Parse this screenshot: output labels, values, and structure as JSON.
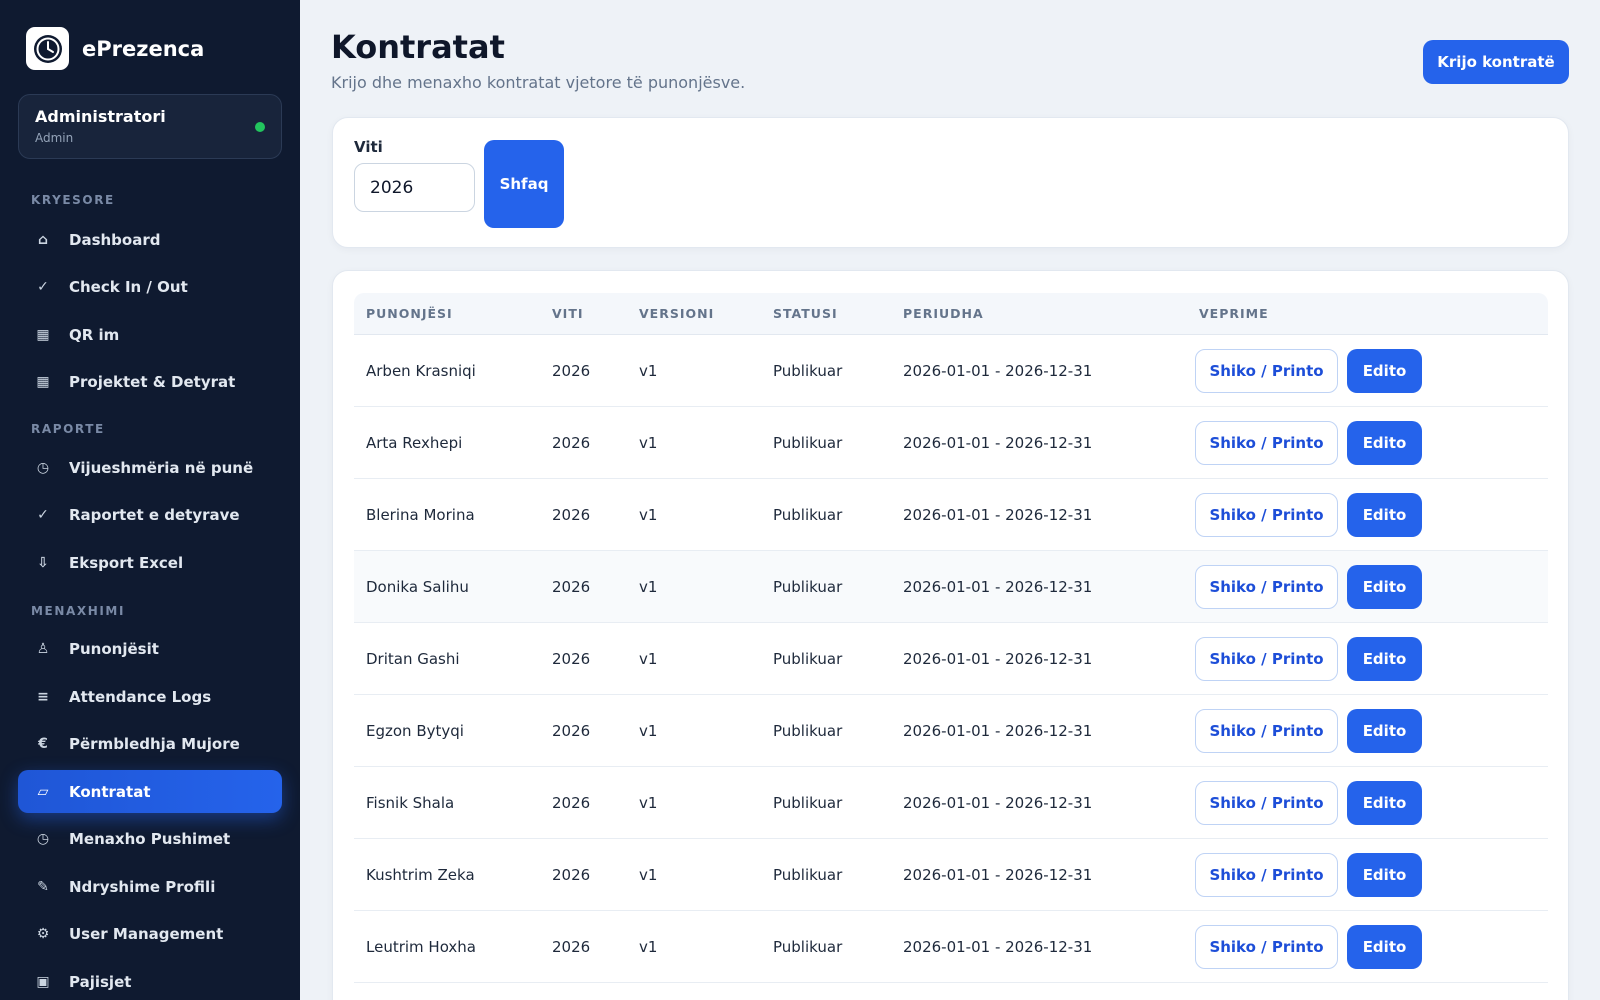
{
  "app": {
    "name": "ePrezenca",
    "logo_icon": "clock-icon"
  },
  "user": {
    "name": "Administratori",
    "role": "Admin",
    "status_color": "#22c55e"
  },
  "sidebar": {
    "sections": [
      {
        "title": "KRYESORE"
      },
      {
        "title": "RAPORTE"
      },
      {
        "title": "MENAXHIMI"
      }
    ],
    "items": [
      {
        "label": "Dashboard",
        "glyph": "⌂"
      },
      {
        "label": "Check In / Out",
        "glyph": "✓"
      },
      {
        "label": "QR im",
        "glyph": "▦"
      },
      {
        "label": "Projektet & Detyrat",
        "glyph": "▦"
      },
      {
        "label": "Vijueshmëria në punë",
        "glyph": "◷"
      },
      {
        "label": "Raportet e detyrave",
        "glyph": "✓"
      },
      {
        "label": "Eksport Excel",
        "glyph": "⇩"
      },
      {
        "label": "Punonjësit",
        "glyph": "♙"
      },
      {
        "label": "Attendance Logs",
        "glyph": "≡"
      },
      {
        "label": "Përmbledhja Mujore",
        "glyph": "€"
      },
      {
        "label": "Kontratat",
        "glyph": "▱",
        "active": true
      },
      {
        "label": "Menaxho Pushimet",
        "glyph": "◷"
      },
      {
        "label": "Ndryshime Profili",
        "glyph": "✎"
      },
      {
        "label": "User Management",
        "glyph": "⚙"
      },
      {
        "label": "Pajisjet",
        "glyph": "▣"
      }
    ]
  },
  "header": {
    "title": "Kontratat",
    "subtitle": "Krijo dhe menaxho kontratat vjetore të punonjësve.",
    "create_label": "Krijo kontratë"
  },
  "filter": {
    "label": "Viti",
    "year_value": "2026",
    "show_label": "Shfaq"
  },
  "table": {
    "columns": [
      "PUNONJËSI",
      "VITI",
      "VERSIONI",
      "STATUSI",
      "PERIUDHA",
      "VEPRIME"
    ],
    "view_label": "Shiko / Printo",
    "edit_label": "Edito",
    "rows": [
      {
        "employee": "Arben Krasniqi",
        "year": "2026",
        "version": "v1",
        "status": "Publikuar",
        "period": "2026-01-01 - 2026-12-31"
      },
      {
        "employee": "Arta Rexhepi",
        "year": "2026",
        "version": "v1",
        "status": "Publikuar",
        "period": "2026-01-01 - 2026-12-31"
      },
      {
        "employee": "Blerina Morina",
        "year": "2026",
        "version": "v1",
        "status": "Publikuar",
        "period": "2026-01-01 - 2026-12-31"
      },
      {
        "employee": "Donika Salihu",
        "year": "2026",
        "version": "v1",
        "status": "Publikuar",
        "period": "2026-01-01 - 2026-12-31"
      },
      {
        "employee": "Dritan Gashi",
        "year": "2026",
        "version": "v1",
        "status": "Publikuar",
        "period": "2026-01-01 - 2026-12-31"
      },
      {
        "employee": "Egzon Bytyqi",
        "year": "2026",
        "version": "v1",
        "status": "Publikuar",
        "period": "2026-01-01 - 2026-12-31"
      },
      {
        "employee": "Fisnik Shala",
        "year": "2026",
        "version": "v1",
        "status": "Publikuar",
        "period": "2026-01-01 - 2026-12-31"
      },
      {
        "employee": "Kushtrim Zeka",
        "year": "2026",
        "version": "v1",
        "status": "Publikuar",
        "period": "2026-01-01 - 2026-12-31"
      },
      {
        "employee": "Leutrim Hoxha",
        "year": "2026",
        "version": "v1",
        "status": "Publikuar",
        "period": "2026-01-01 - 2026-12-31"
      }
    ]
  },
  "colors": {
    "accent": "#2563eb",
    "sidebar_bg": "#0f1a30",
    "page_bg": "#eef2f7"
  }
}
